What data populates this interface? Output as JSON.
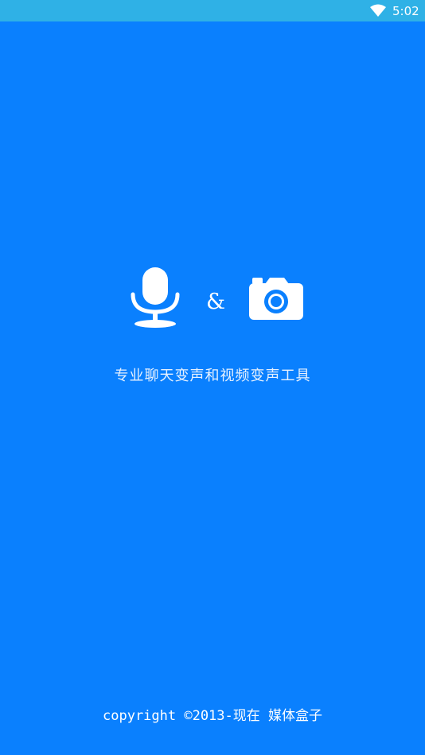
{
  "status_bar": {
    "time": "5:02",
    "wifi_icon": "wifi-icon",
    "background": "#2fb1e6"
  },
  "splash": {
    "background": "#0a80fe",
    "icons": [
      "microphone-icon",
      "camera-icon"
    ],
    "ampersand": "&",
    "tagline": "专业聊天变声和视频变声工具",
    "copyright": "copyright ©2013-现在 媒体盒子"
  }
}
